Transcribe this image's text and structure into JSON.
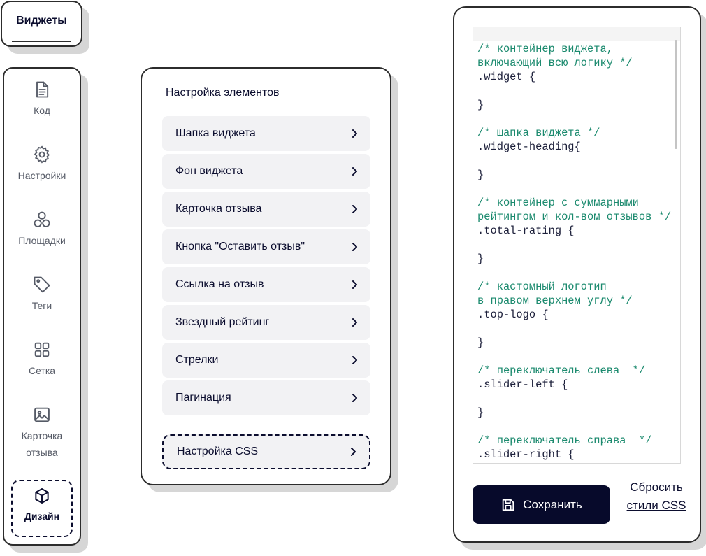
{
  "app": {
    "title": "Виджеты"
  },
  "sidebar": {
    "items": [
      {
        "label": "Код",
        "icon": "file-text-icon"
      },
      {
        "label": "Настройки",
        "icon": "gear-icon"
      },
      {
        "label": "Площадки",
        "icon": "circles-icon"
      },
      {
        "label": "Теги",
        "icon": "tag-icon"
      },
      {
        "label": "Сетка",
        "icon": "grid-icon"
      },
      {
        "label": "Карточка\nотзыва",
        "icon": "image-icon"
      },
      {
        "label": "Дизайн",
        "icon": "cube-icon",
        "active": true
      }
    ]
  },
  "elements": {
    "title": "Настройка элементов",
    "items": [
      {
        "label": "Шапка виджета"
      },
      {
        "label": "Фон виджета"
      },
      {
        "label": "Карточка отзыва"
      },
      {
        "label": "Кнопка \"Оставить отзыв\""
      },
      {
        "label": "Ссылка на отзыв"
      },
      {
        "label": "Звездный рейтинг"
      },
      {
        "label": "Стрелки"
      },
      {
        "label": "Пагинация"
      }
    ],
    "css_item": {
      "label": "Настройка CSS"
    }
  },
  "css_editor": {
    "lines": [
      {
        "text": "/* контейнер виджета,",
        "kind": "comment"
      },
      {
        "text": "включающий всю логику */",
        "kind": "comment"
      },
      {
        "text": ".widget {",
        "kind": "code"
      },
      {
        "text": "",
        "kind": "code"
      },
      {
        "text": "}",
        "kind": "code"
      },
      {
        "text": "",
        "kind": "code"
      },
      {
        "text": "/* шапка виджета */",
        "kind": "comment"
      },
      {
        "text": ".widget-heading{",
        "kind": "code"
      },
      {
        "text": "",
        "kind": "code"
      },
      {
        "text": "}",
        "kind": "code"
      },
      {
        "text": "",
        "kind": "code"
      },
      {
        "text": "/* контейнер с суммарными",
        "kind": "comment"
      },
      {
        "text": "рейтингом и кол-вом отзывов */",
        "kind": "comment"
      },
      {
        "text": ".total-rating {",
        "kind": "code"
      },
      {
        "text": "",
        "kind": "code"
      },
      {
        "text": "}",
        "kind": "code"
      },
      {
        "text": "",
        "kind": "code"
      },
      {
        "text": "/* кастомный логотип",
        "kind": "comment"
      },
      {
        "text": "в правом верхнем углу */",
        "kind": "comment"
      },
      {
        "text": ".top-logo {",
        "kind": "code"
      },
      {
        "text": "",
        "kind": "code"
      },
      {
        "text": "}",
        "kind": "code"
      },
      {
        "text": "",
        "kind": "code"
      },
      {
        "text": "/* переключатель слева  */",
        "kind": "comment"
      },
      {
        "text": ".slider-left {",
        "kind": "code"
      },
      {
        "text": "",
        "kind": "code"
      },
      {
        "text": "}",
        "kind": "code"
      },
      {
        "text": "",
        "kind": "code"
      },
      {
        "text": "/* переключатель справа  */",
        "kind": "comment"
      },
      {
        "text": ".slider-right {",
        "kind": "code"
      }
    ],
    "save_label": "Сохранить",
    "reset_label": "Сбросить стили CSS"
  },
  "colors": {
    "accent": "#070a2b",
    "comment": "#1b8a6e",
    "row_bg": "#f2f2f4"
  }
}
